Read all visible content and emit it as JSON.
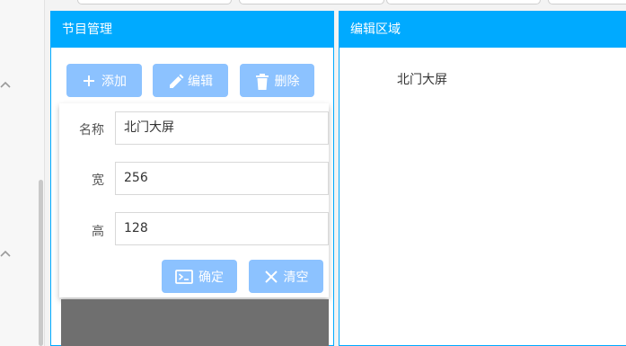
{
  "left_panel": {
    "title": "节目管理"
  },
  "toolbar": {
    "add_label": "添加",
    "edit_label": "编辑",
    "delete_label": "删除"
  },
  "form": {
    "name_label": "名称",
    "name_value": "北门大屏",
    "width_label": "宽",
    "width_value": "256",
    "height_label": "高",
    "height_value": "128",
    "confirm_label": "确定",
    "clear_label": "清空"
  },
  "right_panel": {
    "title": "编辑区域",
    "item_text": "北门大屏"
  },
  "colors": {
    "accent": "#00aaff",
    "button": "#8cc2ff"
  }
}
